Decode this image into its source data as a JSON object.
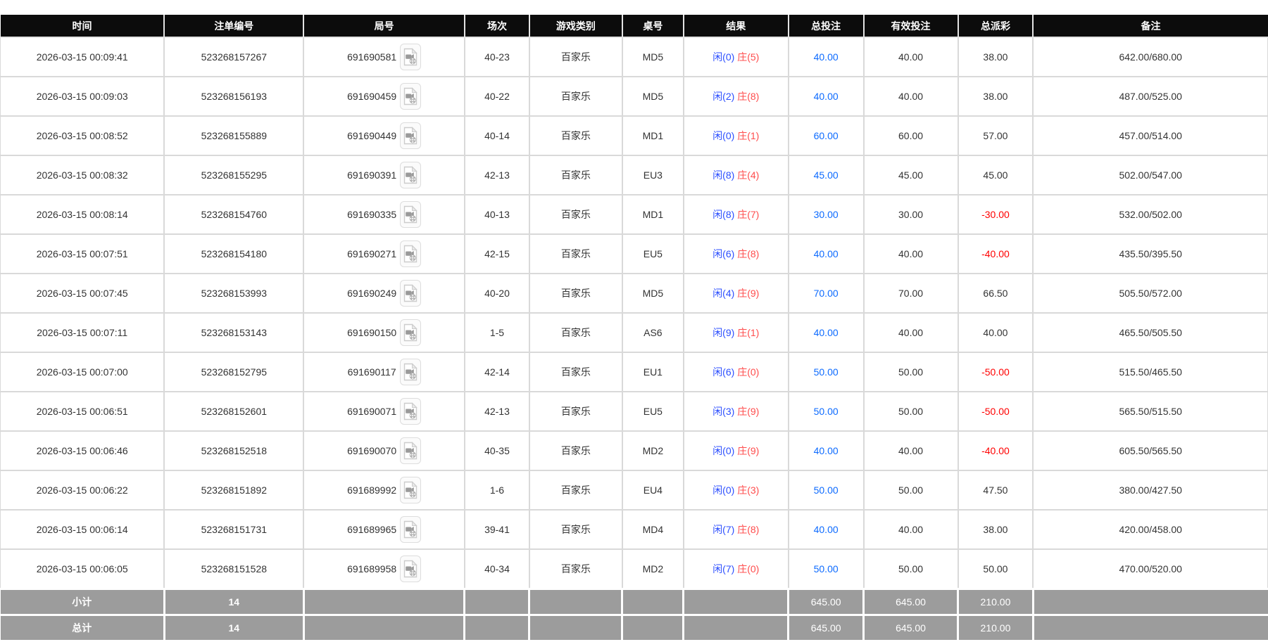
{
  "table": {
    "columns": [
      {
        "label": "时间"
      },
      {
        "label": "注单编号"
      },
      {
        "label": "局号"
      },
      {
        "label": "场次"
      },
      {
        "label": "游戏类别"
      },
      {
        "label": "桌号"
      },
      {
        "label": "结果"
      },
      {
        "label": "总投注"
      },
      {
        "label": "有效投注"
      },
      {
        "label": "总派彩"
      },
      {
        "label": "备注"
      }
    ],
    "rows": [
      {
        "time": "2026-03-15 00:09:41",
        "bet_no": "523268157267",
        "round_no": "691690581",
        "session": "40-23",
        "game_type": "百家乐",
        "table_no": "MD5",
        "result_player": "闲(0)",
        "result_banker": "庄(5)",
        "total_bet": "40.00",
        "valid_bet": "40.00",
        "total_payout": "38.00",
        "remark": "642.00/680.00"
      },
      {
        "time": "2026-03-15 00:09:03",
        "bet_no": "523268156193",
        "round_no": "691690459",
        "session": "40-22",
        "game_type": "百家乐",
        "table_no": "MD5",
        "result_player": "闲(2)",
        "result_banker": "庄(8)",
        "total_bet": "40.00",
        "valid_bet": "40.00",
        "total_payout": "38.00",
        "remark": "487.00/525.00"
      },
      {
        "time": "2026-03-15 00:08:52",
        "bet_no": "523268155889",
        "round_no": "691690449",
        "session": "40-14",
        "game_type": "百家乐",
        "table_no": "MD1",
        "result_player": "闲(0)",
        "result_banker": "庄(1)",
        "total_bet": "60.00",
        "valid_bet": "60.00",
        "total_payout": "57.00",
        "remark": "457.00/514.00"
      },
      {
        "time": "2026-03-15 00:08:32",
        "bet_no": "523268155295",
        "round_no": "691690391",
        "session": "42-13",
        "game_type": "百家乐",
        "table_no": "EU3",
        "result_player": "闲(8)",
        "result_banker": "庄(4)",
        "total_bet": "45.00",
        "valid_bet": "45.00",
        "total_payout": "45.00",
        "remark": "502.00/547.00"
      },
      {
        "time": "2026-03-15 00:08:14",
        "bet_no": "523268154760",
        "round_no": "691690335",
        "session": "40-13",
        "game_type": "百家乐",
        "table_no": "MD1",
        "result_player": "闲(8)",
        "result_banker": "庄(7)",
        "total_bet": "30.00",
        "valid_bet": "30.00",
        "total_payout": "-30.00",
        "remark": "532.00/502.00"
      },
      {
        "time": "2026-03-15 00:07:51",
        "bet_no": "523268154180",
        "round_no": "691690271",
        "session": "42-15",
        "game_type": "百家乐",
        "table_no": "EU5",
        "result_player": "闲(6)",
        "result_banker": "庄(8)",
        "total_bet": "40.00",
        "valid_bet": "40.00",
        "total_payout": "-40.00",
        "remark": "435.50/395.50"
      },
      {
        "time": "2026-03-15 00:07:45",
        "bet_no": "523268153993",
        "round_no": "691690249",
        "session": "40-20",
        "game_type": "百家乐",
        "table_no": "MD5",
        "result_player": "闲(4)",
        "result_banker": "庄(9)",
        "total_bet": "70.00",
        "valid_bet": "70.00",
        "total_payout": "66.50",
        "remark": "505.50/572.00"
      },
      {
        "time": "2026-03-15 00:07:11",
        "bet_no": "523268153143",
        "round_no": "691690150",
        "session": "1-5",
        "game_type": "百家乐",
        "table_no": "AS6",
        "result_player": "闲(9)",
        "result_banker": "庄(1)",
        "total_bet": "40.00",
        "valid_bet": "40.00",
        "total_payout": "40.00",
        "remark": "465.50/505.50"
      },
      {
        "time": "2026-03-15 00:07:00",
        "bet_no": "523268152795",
        "round_no": "691690117",
        "session": "42-14",
        "game_type": "百家乐",
        "table_no": "EU1",
        "result_player": "闲(6)",
        "result_banker": "庄(0)",
        "total_bet": "50.00",
        "valid_bet": "50.00",
        "total_payout": "-50.00",
        "remark": "515.50/465.50"
      },
      {
        "time": "2026-03-15 00:06:51",
        "bet_no": "523268152601",
        "round_no": "691690071",
        "session": "42-13",
        "game_type": "百家乐",
        "table_no": "EU5",
        "result_player": "闲(3)",
        "result_banker": "庄(9)",
        "total_bet": "50.00",
        "valid_bet": "50.00",
        "total_payout": "-50.00",
        "remark": "565.50/515.50"
      },
      {
        "time": "2026-03-15 00:06:46",
        "bet_no": "523268152518",
        "round_no": "691690070",
        "session": "40-35",
        "game_type": "百家乐",
        "table_no": "MD2",
        "result_player": "闲(0)",
        "result_banker": "庄(9)",
        "total_bet": "40.00",
        "valid_bet": "40.00",
        "total_payout": "-40.00",
        "remark": "605.50/565.50"
      },
      {
        "time": "2026-03-15 00:06:22",
        "bet_no": "523268151892",
        "round_no": "691689992",
        "session": "1-6",
        "game_type": "百家乐",
        "table_no": "EU4",
        "result_player": "闲(0)",
        "result_banker": "庄(3)",
        "total_bet": "50.00",
        "valid_bet": "50.00",
        "total_payout": "47.50",
        "remark": "380.00/427.50"
      },
      {
        "time": "2026-03-15 00:06:14",
        "bet_no": "523268151731",
        "round_no": "691689965",
        "session": "39-41",
        "game_type": "百家乐",
        "table_no": "MD4",
        "result_player": "闲(7)",
        "result_banker": "庄(8)",
        "total_bet": "40.00",
        "valid_bet": "40.00",
        "total_payout": "38.00",
        "remark": "420.00/458.00"
      },
      {
        "time": "2026-03-15 00:06:05",
        "bet_no": "523268151528",
        "round_no": "691689958",
        "session": "40-34",
        "game_type": "百家乐",
        "table_no": "MD2",
        "result_player": "闲(7)",
        "result_banker": "庄(0)",
        "total_bet": "50.00",
        "valid_bet": "50.00",
        "total_payout": "50.00",
        "remark": "470.00/520.00"
      }
    ],
    "footer": {
      "subtotal": {
        "label": "小计",
        "count": "14",
        "total_bet": "645.00",
        "valid_bet": "645.00",
        "total_payout": "210.00"
      },
      "grand_total": {
        "label": "总计",
        "count": "14",
        "total_bet": "645.00",
        "valid_bet": "645.00",
        "total_payout": "210.00"
      }
    }
  },
  "icons": {
    "round_replay": "video-file-icon"
  },
  "colors": {
    "header_bg": "#0c0c0c",
    "body_border": "#d9d9d9",
    "footer_bg": "#9c9c9c",
    "link_blue": "#0d6bff",
    "player_blue": "#2b4eff",
    "banker_red": "#ff4d4d",
    "negative_red": "#ff0000"
  }
}
